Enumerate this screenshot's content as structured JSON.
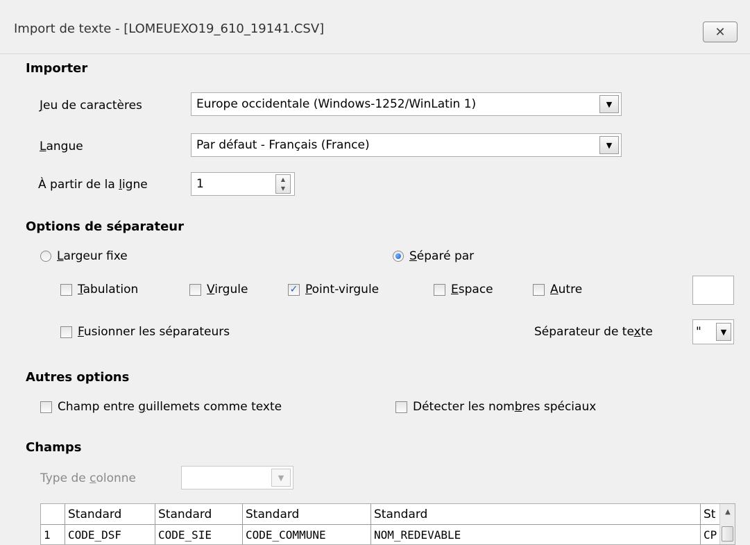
{
  "window": {
    "title": "Import de texte - [LOMEUEXO19_610_19141.CSV]",
    "close_icon": "✕"
  },
  "import": {
    "heading": "Importer",
    "charset_label_hotkey": "J",
    "charset_label_rest": "eu de caractères",
    "charset_value": "Europe occidentale (Windows-1252/WinLatin 1)",
    "language_label_hotkey": "L",
    "language_label_rest": "angue",
    "language_value": "Par défaut - Français (France)",
    "from_row_label_pre": "À partir de la ",
    "from_row_label_hotkey": "l",
    "from_row_label_post": "igne",
    "from_row_value": "1"
  },
  "separator": {
    "heading": "Options de séparateur",
    "fixed_width_hotkey": "L",
    "fixed_width_rest": "argeur fixe",
    "fixed_width_selected": false,
    "separated_by_hotkey": "S",
    "separated_by_rest": "éparé par",
    "separated_by_selected": true,
    "tab_hotkey": "T",
    "tab_rest": "abulation",
    "tab_checked": false,
    "comma_hotkey": "V",
    "comma_rest": "irgule",
    "comma_checked": false,
    "semicolon_hotkey": "P",
    "semicolon_rest": "oint-virgule",
    "semicolon_checked": true,
    "space_hotkey": "E",
    "space_rest": "space",
    "space_checked": false,
    "other_hotkey": "A",
    "other_rest": "utre",
    "other_checked": false,
    "other_value": "",
    "merge_hotkey": "F",
    "merge_rest": "usionner les séparateurs",
    "merge_checked": false,
    "text_delim_pre": "Séparateur de te",
    "text_delim_hotkey": "x",
    "text_delim_post": "te",
    "text_delim_value": "\""
  },
  "other_options": {
    "heading": "Autres options",
    "quoted_pre": "Champ entre ",
    "quoted_hotkey": "g",
    "quoted_post": "uillemets comme texte",
    "quoted_checked": false,
    "special_pre": "Détecter les nom",
    "special_hotkey": "b",
    "special_post": "res spéciaux",
    "special_checked": false
  },
  "fields": {
    "heading": "Champs",
    "column_type_pre": "Type de ",
    "column_type_hotkey": "c",
    "column_type_post": "olonne",
    "column_type_value": "",
    "headers": [
      "Standard",
      "Standard",
      "Standard",
      "Standard",
      "St"
    ],
    "row_number": "1",
    "row_values": [
      "CODE_DSF",
      "CODE_SIE",
      "CODE_COMMUNE",
      "NOM_REDEVABLE",
      "CP"
    ]
  },
  "icons": {
    "dropdown": "chevron-down-icon",
    "spin": "spin-arrows-icon",
    "checkmark": "✓",
    "scroll_up": "▲",
    "dropdown_glyph": "▼",
    "spin_up_glyph": "▲",
    "spin_down_glyph": "▼"
  }
}
